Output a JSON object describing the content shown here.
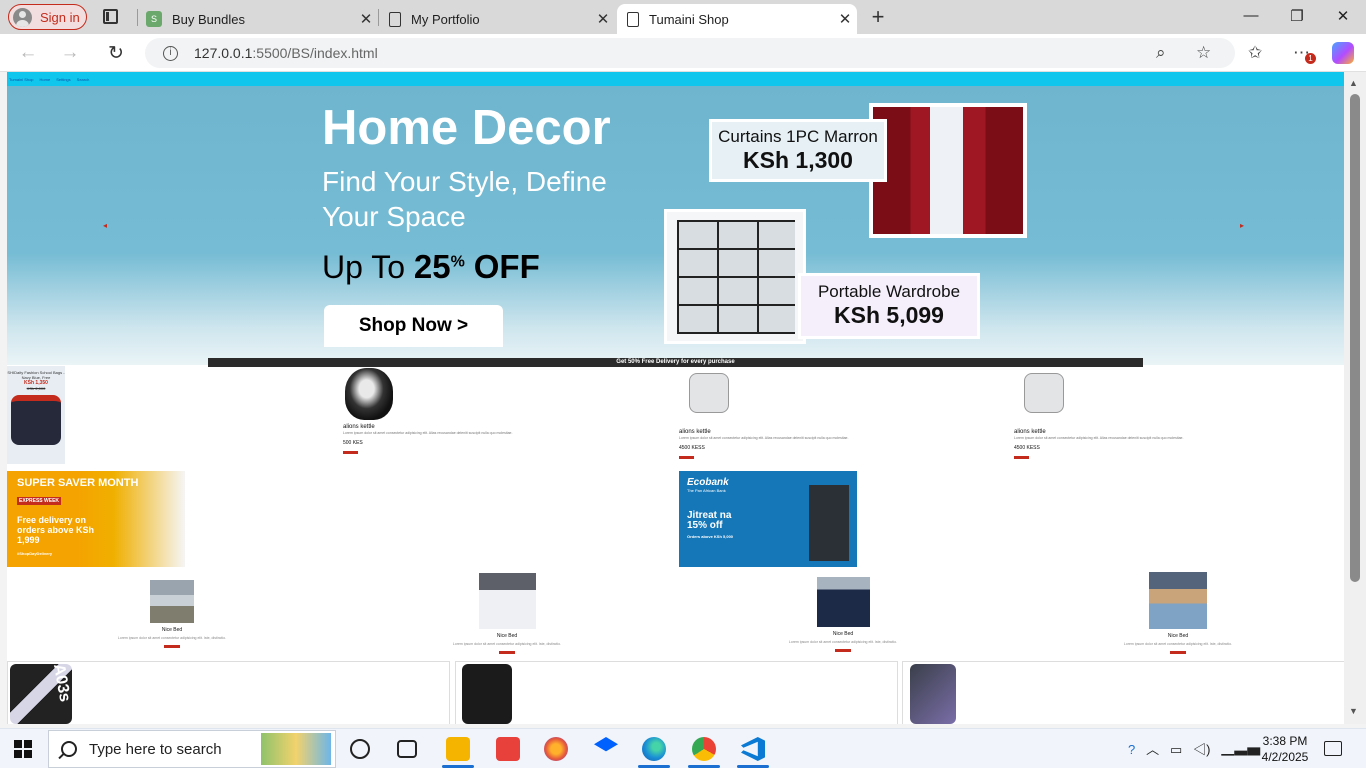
{
  "browser": {
    "sign_in": "Sign in",
    "tabs": [
      {
        "label": "Buy Bundles",
        "favicon": "green-s-favicon"
      },
      {
        "label": "My Portfolio",
        "favicon": "document-icon"
      },
      {
        "label": "Tumaini Shop",
        "favicon": "document-icon"
      }
    ],
    "close_glyph": "✕",
    "new_tab": "+",
    "url": "127.0.0.1:5500/BS/index.html",
    "url_host": "127.0.0.1",
    "url_rest": ":5500/BS/index.html",
    "extensions_badge": "1"
  },
  "site": {
    "nav_items": [
      "Tumaini Shop",
      "Home",
      "Settings",
      "Search"
    ],
    "hero": {
      "title": "Home Decor",
      "subtitle": "Find Your Style, Define Your Space",
      "offer_prefix": "Up To",
      "offer_value": "25",
      "offer_unit": "%",
      "offer_suffix": "OFF",
      "button": "Shop Now >",
      "curtain_name": "Curtains 1PC Marron",
      "curtain_price": "KSh 1,300",
      "wardrobe_name": "Portable Wardrobe",
      "wardrobe_price": "KSh 5,099",
      "strip": "Get 50% Free Delivery for every purchase"
    },
    "bag_ad": {
      "title": "SHIDaity Fashion School Bags - Navy Blue, Free",
      "price": "KSh 1,350",
      "old_price": "KSh 2,000",
      "cta": "Order Now"
    },
    "products": [
      {
        "name": "alions kettle",
        "desc": "Lorem ipsum dolor sit amet consectetur adipisicing elit. Alias recusandae deleniti suscipit nulla quo molestiae.",
        "price": "500 KES",
        "kind": "kettle"
      },
      {
        "name": "alions kettle",
        "desc": "Lorem ipsum dolor sit amet consectetur adipisicing elit. Alias recusandae deleniti suscipit nulla quo molestiae.",
        "price": "4500 KESS",
        "kind": "toaster"
      },
      {
        "name": "alions kettle",
        "desc": "Lorem ipsum dolor sit amet consectetur adipisicing elit. Alias recusandae deleniti suscipit nulla quo molestiae.",
        "price": "4500 KESS",
        "kind": "toaster"
      }
    ],
    "supersaver": {
      "title": "SUPER SAVER MONTH",
      "tag": "EXPRESS WEEK",
      "line": "Free delivery on orders above KSh 1,999",
      "footer": "#ShopDayDelivery",
      "cta": "SHOP NOW >"
    },
    "ecobank": {
      "logo": "Ecobank",
      "tagline": "The Pan African Bank",
      "title": "Jitreat na 15% off",
      "note": "Orders above KSh 5,000"
    },
    "beds": [
      {
        "name": "Nice Bed",
        "desc": "Lorem ipsum dolor sit amet consectetur adipisicing elit. Iste, distinctio."
      },
      {
        "name": "Nice Bed",
        "desc": "Lorem ipsum dolor sit amet consectetur adipisicing elit. Iste, distinctio."
      },
      {
        "name": "Nice Bed",
        "desc": "Lorem ipsum dolor sit amet consectetur adipisicing elit. Iste, distinctio."
      },
      {
        "name": "Nice Bed",
        "desc": "Lorem ipsum dolor sit amet consectetur adipisicing elit. Iste, distinctio."
      }
    ],
    "phones": [
      "A03s"
    ]
  },
  "taskbar": {
    "search_placeholder": "Type here to search",
    "time": "3:38 PM",
    "date": "4/2/2025"
  },
  "colors": {
    "site_nav": "#10c6ec",
    "accent_red": "#c42b1c",
    "hero_bg": "#6fb5ce"
  }
}
